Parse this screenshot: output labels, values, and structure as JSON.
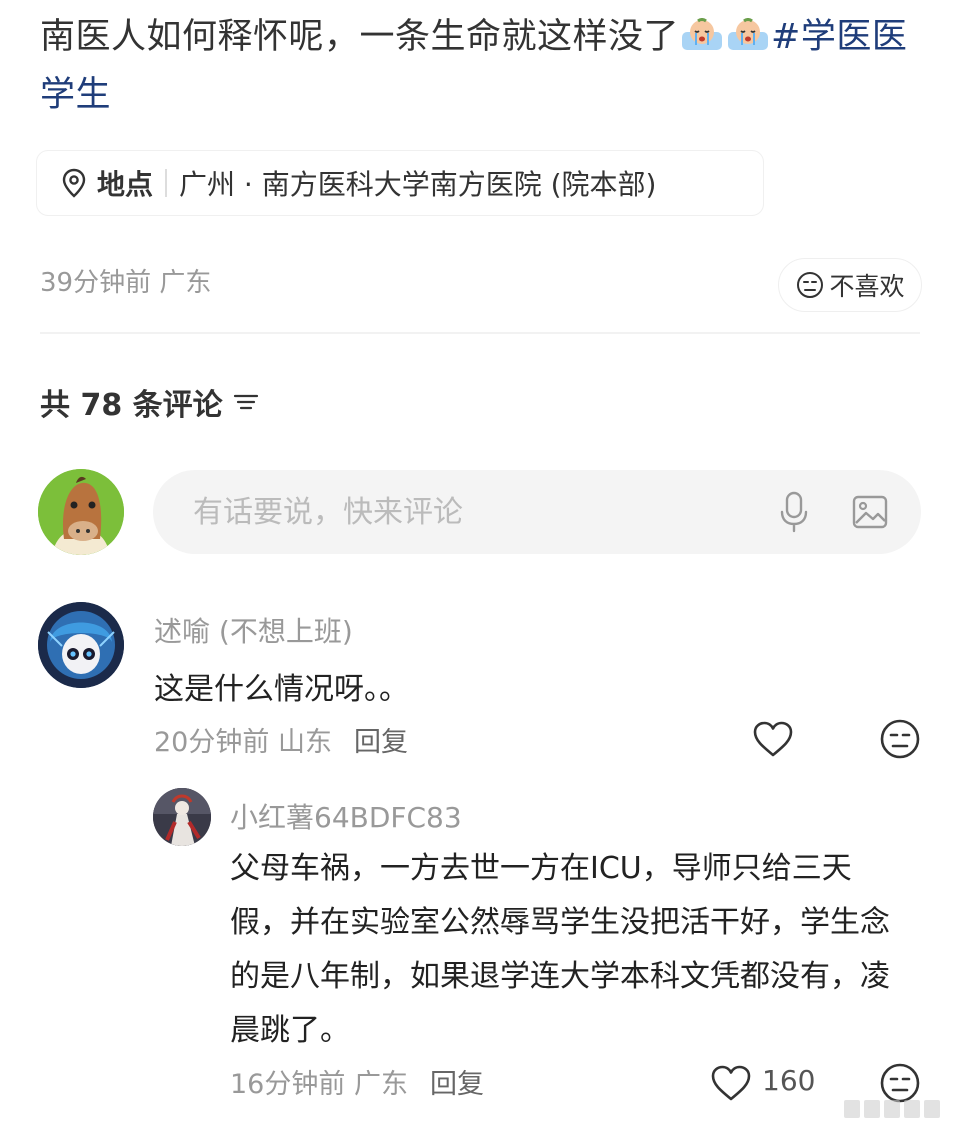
{
  "post": {
    "text": "南医人如何释怀呢，一条生命就这样没了",
    "emojis": [
      "crying-face-emoji",
      "crying-face-emoji"
    ],
    "hashtag": "#学医医学生"
  },
  "location": {
    "label": "地点",
    "name": "广州 · 南方医科大学南方医院 (院本部)"
  },
  "post_meta": {
    "time_region": "39分钟前 广东",
    "dislike_label": "不喜欢"
  },
  "comments_header": {
    "count_label": "共 78 条评论"
  },
  "comment_input": {
    "placeholder": "有话要说，快来评论"
  },
  "comments": [
    {
      "author": "述喻 (不想上班)",
      "text": "这是什么情况呀。。",
      "time_region": "20分钟前 山东",
      "reply_label": "回复",
      "replies": [
        {
          "author": "小红薯64BDFC83",
          "text": "父母车祸，一方去世一方在ICU，导师只给三天假，并在实验室公然辱骂学生没把活干好，学生念的是八年制，如果退学连大学本科文凭都没有，凌晨跳了。",
          "time_region": "16分钟前 广东",
          "reply_label": "回复",
          "likes": "160"
        }
      ]
    }
  ],
  "colors": {
    "text": "#333333",
    "muted": "#999999",
    "hashtag": "#1f3d7a",
    "input_bg": "#f4f4f4"
  }
}
